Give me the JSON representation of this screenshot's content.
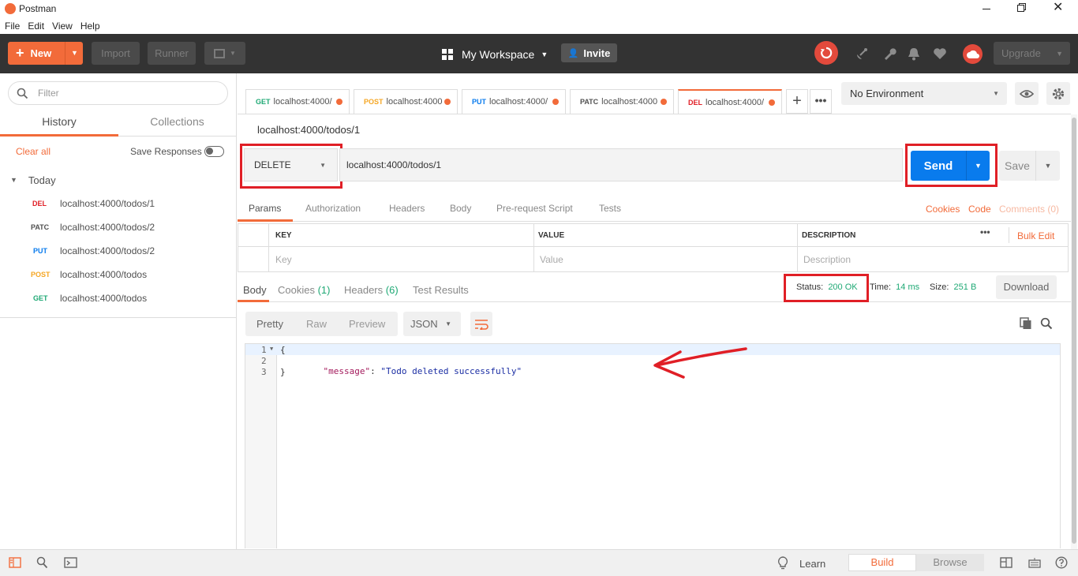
{
  "window": {
    "title": "Postman"
  },
  "menu": [
    "File",
    "Edit",
    "View",
    "Help"
  ],
  "header": {
    "new_label": "New",
    "import_label": "Import",
    "runner_label": "Runner",
    "workspace_label": "My Workspace",
    "invite_label": "Invite",
    "upgrade_label": "Upgrade"
  },
  "sidebar": {
    "filter_placeholder": "Filter",
    "tab_history": "History",
    "tab_collections": "Collections",
    "clear_all": "Clear all",
    "save_responses": "Save Responses",
    "group_today": "Today",
    "items": [
      {
        "method": "DEL",
        "url": "localhost:4000/todos/1"
      },
      {
        "method": "PATC",
        "url": "localhost:4000/todos/2"
      },
      {
        "method": "PUT",
        "url": "localhost:4000/todos/2"
      },
      {
        "method": "POST",
        "url": "localhost:4000/todos"
      },
      {
        "method": "GET",
        "url": "localhost:4000/todos"
      }
    ]
  },
  "tabs": [
    {
      "method": "GET",
      "url": "localhost:4000/"
    },
    {
      "method": "POST",
      "url": "localhost:4000"
    },
    {
      "method": "PUT",
      "url": "localhost:4000/"
    },
    {
      "method": "PATC",
      "url": "localhost:4000"
    },
    {
      "method": "DEL",
      "url": "localhost:4000/"
    }
  ],
  "environment": {
    "selected": "No Environment"
  },
  "request": {
    "title": "localhost:4000/todos/1",
    "method": "DELETE",
    "url": "localhost:4000/todos/1",
    "send_label": "Send",
    "save_label": "Save"
  },
  "request_tabs": [
    "Params",
    "Authorization",
    "Headers",
    "Body",
    "Pre-request Script",
    "Tests"
  ],
  "request_links": {
    "cookies": "Cookies",
    "code": "Code",
    "comments": "Comments (0)"
  },
  "params_table": {
    "headers": [
      "KEY",
      "VALUE",
      "DESCRIPTION"
    ],
    "bulk_edit": "Bulk Edit",
    "placeholders": [
      "Key",
      "Value",
      "Description"
    ]
  },
  "response_tabs": {
    "body": "Body",
    "cookies": "Cookies",
    "cookies_count": "(1)",
    "headers": "Headers",
    "headers_count": "(6)",
    "tests": "Test Results"
  },
  "response_meta": {
    "status_label": "Status:",
    "status_value": "200 OK",
    "time_label": "Time:",
    "time_value": "14 ms",
    "size_label": "Size:",
    "size_value": "251 B",
    "download_label": "Download"
  },
  "response_view": {
    "pretty": "Pretty",
    "raw": "Raw",
    "preview": "Preview",
    "format": "JSON"
  },
  "code": {
    "line_numbers": [
      "1",
      "2",
      "3"
    ],
    "line1": "{",
    "key": "\"message\"",
    "colon": ": ",
    "value": "\"Todo deleted successfully\"",
    "line3": "}"
  },
  "footer": {
    "learn": "Learn",
    "build": "Build",
    "browse": "Browse"
  },
  "colors": {
    "accent": "#f26b3a",
    "send_blue": "#097bed",
    "highlight_red": "#e01f26",
    "status_green": "#1fa975"
  }
}
